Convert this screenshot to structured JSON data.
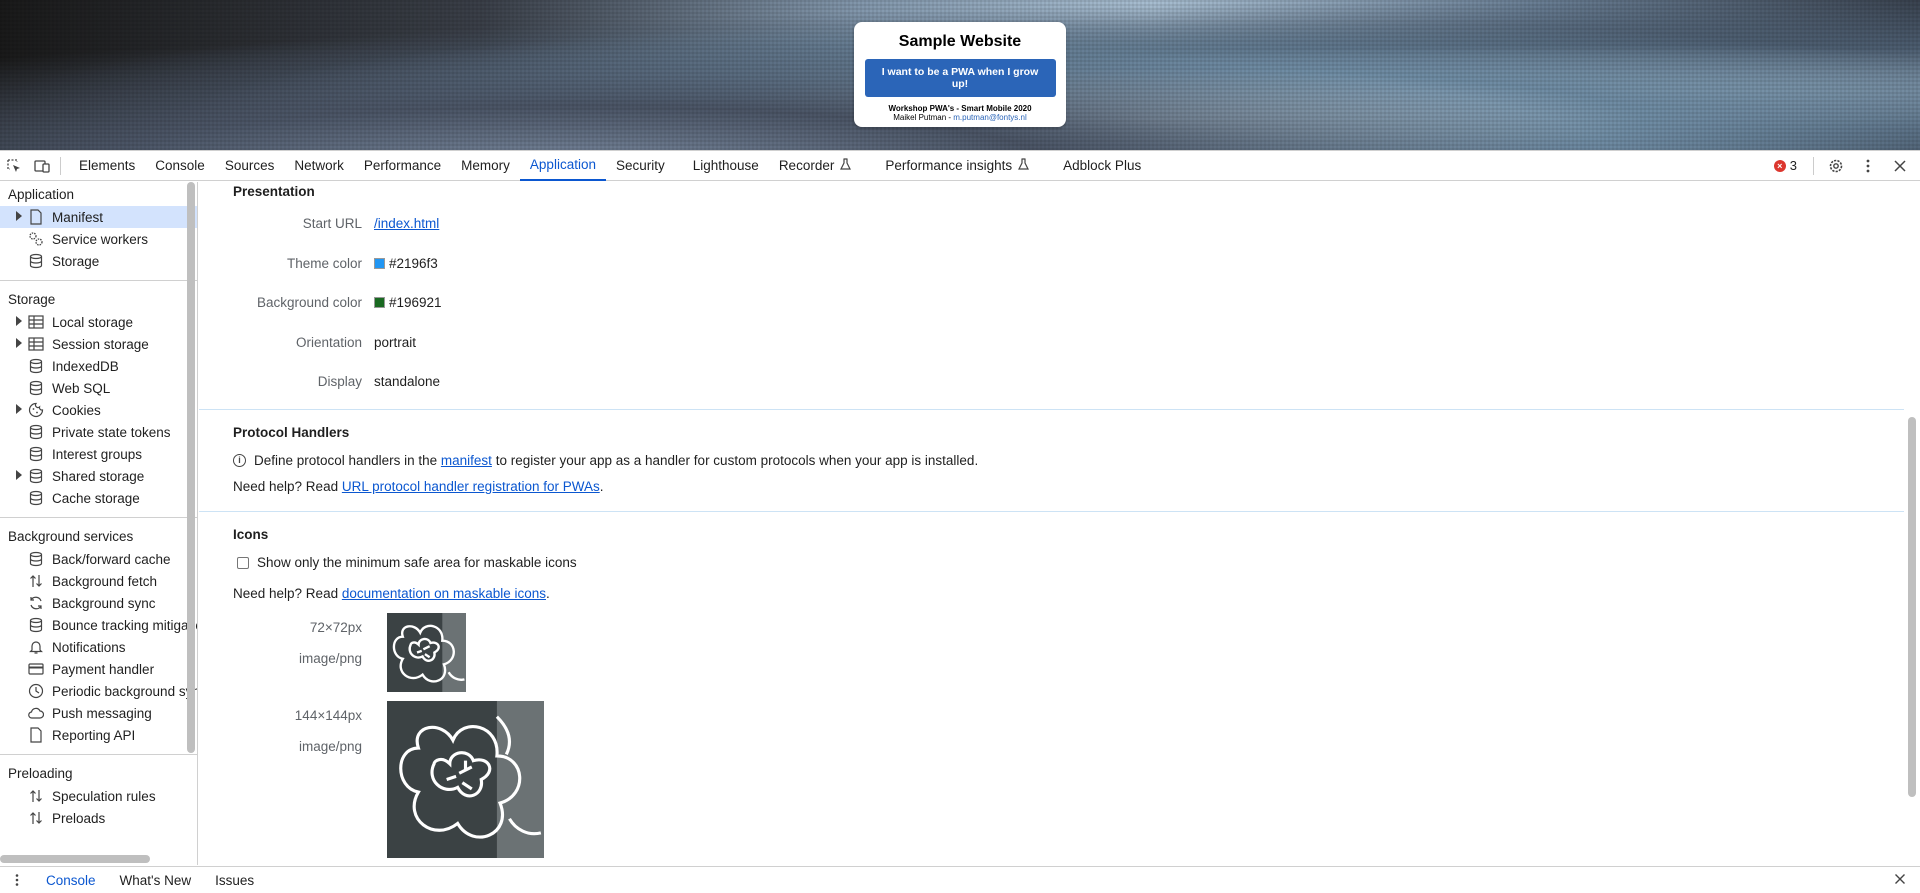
{
  "page": {
    "site_title": "Sample Website",
    "cta_button": "I want to be a PWA when I grow up!",
    "workshop": "Workshop PWA's - Smart Mobile 2020",
    "author_name": "Maikel Putman",
    "author_sep": " - ",
    "author_email": "m.putman@fontys.nl"
  },
  "tabbar": {
    "tabs": [
      "Elements",
      "Console",
      "Sources",
      "Network",
      "Performance",
      "Memory",
      "Application",
      "Security",
      "Lighthouse",
      "Recorder",
      "Performance insights",
      "Adblock Plus"
    ],
    "active_tab": "Application",
    "error_count": "3"
  },
  "sidebar": {
    "sections": [
      {
        "title": "Application",
        "items": [
          {
            "label": "Manifest",
            "icon": "file-icon",
            "arrow": true,
            "selected": true
          },
          {
            "label": "Service workers",
            "icon": "gears-icon",
            "arrow": false
          },
          {
            "label": "Storage",
            "icon": "database-icon",
            "arrow": false
          }
        ]
      },
      {
        "title": "Storage",
        "items": [
          {
            "label": "Local storage",
            "icon": "table-icon",
            "arrow": true
          },
          {
            "label": "Session storage",
            "icon": "table-icon",
            "arrow": true
          },
          {
            "label": "IndexedDB",
            "icon": "database-icon",
            "arrow": false
          },
          {
            "label": "Web SQL",
            "icon": "database-icon",
            "arrow": false
          },
          {
            "label": "Cookies",
            "icon": "cookie-icon",
            "arrow": true
          },
          {
            "label": "Private state tokens",
            "icon": "database-icon",
            "arrow": false
          },
          {
            "label": "Interest groups",
            "icon": "database-icon",
            "arrow": false
          },
          {
            "label": "Shared storage",
            "icon": "database-icon",
            "arrow": true
          },
          {
            "label": "Cache storage",
            "icon": "database-icon",
            "arrow": false
          }
        ]
      },
      {
        "title": "Background services",
        "items": [
          {
            "label": "Back/forward cache",
            "icon": "database-icon",
            "arrow": false
          },
          {
            "label": "Background fetch",
            "icon": "sync-arrows-icon",
            "arrow": false
          },
          {
            "label": "Background sync",
            "icon": "refresh-icon",
            "arrow": false
          },
          {
            "label": "Bounce tracking mitigations",
            "icon": "database-icon",
            "arrow": false
          },
          {
            "label": "Notifications",
            "icon": "bell-icon",
            "arrow": false
          },
          {
            "label": "Payment handler",
            "icon": "credit-card-icon",
            "arrow": false
          },
          {
            "label": "Periodic background sync",
            "icon": "clock-icon",
            "arrow": false
          },
          {
            "label": "Push messaging",
            "icon": "cloud-icon",
            "arrow": false
          },
          {
            "label": "Reporting API",
            "icon": "file-icon",
            "arrow": false
          }
        ]
      },
      {
        "title": "Preloading",
        "items": [
          {
            "label": "Speculation rules",
            "icon": "sync-arrows-icon",
            "arrow": false
          },
          {
            "label": "Preloads",
            "icon": "sync-arrows-icon",
            "arrow": false
          }
        ]
      }
    ]
  },
  "main": {
    "presentation": {
      "title": "Presentation",
      "start_url_label": "Start URL",
      "start_url": "/index.html",
      "theme_color_label": "Theme color",
      "theme_color": "#2196f3",
      "background_color_label": "Background color",
      "background_color": "#196921",
      "orientation_label": "Orientation",
      "orientation": "portrait",
      "display_label": "Display",
      "display": "standalone"
    },
    "protocol_handlers": {
      "title": "Protocol Handlers",
      "info_before": "Define protocol handlers in the ",
      "info_link": "manifest",
      "info_after": " to register your app as a handler for custom protocols when your app is installed.",
      "help_prefix": "Need help? Read ",
      "help_link": "URL protocol handler registration for PWAs",
      "help_suffix": "."
    },
    "icons": {
      "title": "Icons",
      "checkbox_label": "Show only the minimum safe area for maskable icons",
      "help_prefix": "Need help? Read ",
      "help_link": "documentation on maskable icons",
      "help_suffix": ".",
      "list": [
        {
          "size": "72×72px",
          "type": "image/png"
        },
        {
          "size": "144×144px",
          "type": "image/png"
        }
      ]
    }
  },
  "drawer": {
    "tabs": [
      "Console",
      "What's New",
      "Issues"
    ],
    "active_tab": "Console"
  }
}
